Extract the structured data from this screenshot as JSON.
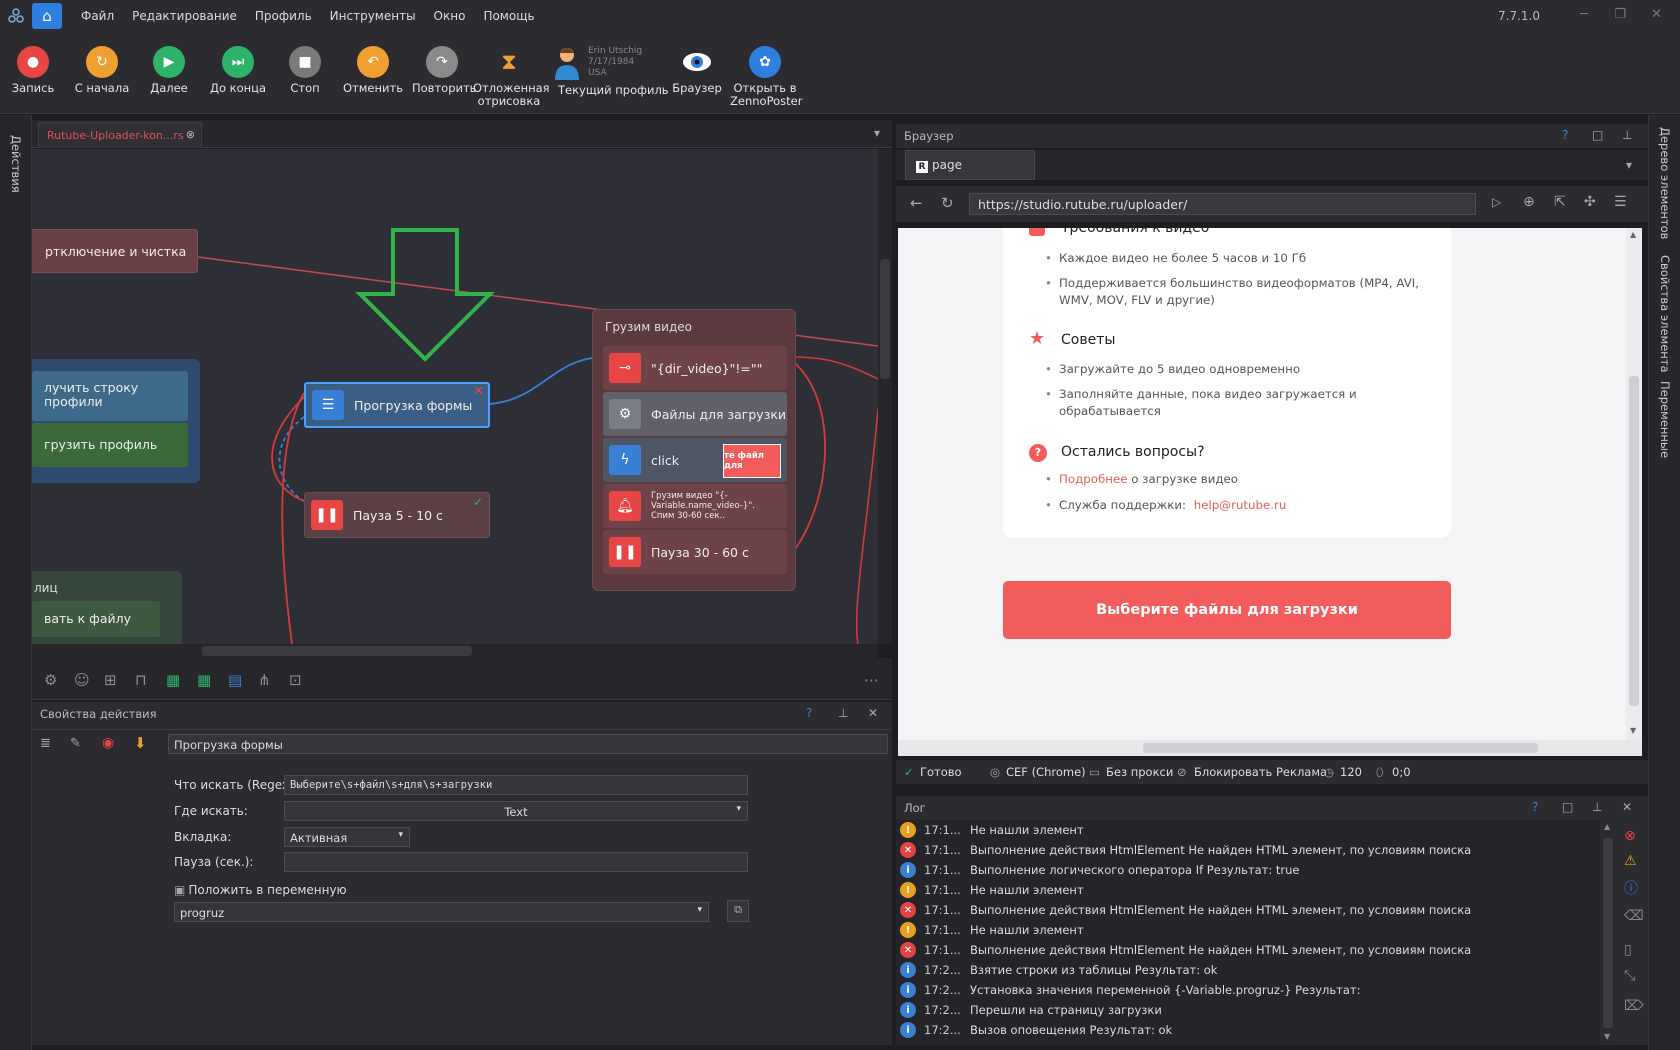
{
  "menu": {
    "items": [
      "Файл",
      "Редактирование",
      "Профиль",
      "Инструменты",
      "Окно",
      "Помощь"
    ],
    "version": "7.7.1.0"
  },
  "toolbar": {
    "buttons": [
      {
        "label": "Запись",
        "color": "#e84545"
      },
      {
        "label": "С начала",
        "color": "#f0a030"
      },
      {
        "label": "Далее",
        "color": "#2fb36a"
      },
      {
        "label": "До конца",
        "color": "#2fb36a"
      },
      {
        "label": "Стоп",
        "color": "#7a7a7a"
      },
      {
        "label": "Отменить",
        "color": "#f0a030"
      },
      {
        "label": "Повторить",
        "color": "#8a8a8a"
      },
      {
        "label": "Отложенная отрисовка",
        "color": "#f0a030"
      }
    ],
    "profile": {
      "name": "Erin Utschig",
      "dob": "7/17/1984",
      "country": "USA",
      "label": "Текущий профиль"
    },
    "browser_label": "Браузер",
    "zp_label": "Открыть в ZennoPoster"
  },
  "left_strip": {
    "label": "Действия"
  },
  "right_strip": {
    "items": [
      "Дерево элементов",
      "Свойства элемента",
      "Переменные"
    ]
  },
  "project_tab": {
    "title": "Rutube-Uploader-kon...rs"
  },
  "canvas": {
    "nodes": {
      "cleanup": "ртключение и чистка",
      "get_row": "лучить строку профили",
      "load_profile": "грузить профиль",
      "form_load": "Прогрузка формы",
      "pause_short": "Пауза 5 - 10 с",
      "group_partial": "лиц",
      "file_path": "вать к файлу"
    },
    "group": {
      "title": "Грузим видео",
      "items": [
        {
          "label": "\"{dir_video}\"!=\"\""
        },
        {
          "label": "Файлы для загрузки"
        },
        {
          "label": "click",
          "thumb": "те файл для"
        },
        {
          "label": "Грузим видео \"{-Variable.name_video-}\". Спим 30-60 сек.."
        },
        {
          "label": "Пауза 30 - 60 с"
        }
      ]
    }
  },
  "properties": {
    "title": "Свойства действия",
    "name": "Прогрузка формы",
    "fields": {
      "regex_label": "Что искать (Regex):",
      "regex_value": "Выберите\\s+файл\\s+для\\s+загрузки",
      "where_label": "Где искать:",
      "where_value": "Text",
      "tab_label": "Вкладка:",
      "tab_value": "Активная",
      "pause_label": "Пауза (сек.):",
      "save_label": "Положить в переменную",
      "var_value": "progruz"
    }
  },
  "browser": {
    "title": "Браузер",
    "tab": "page",
    "url": "https://studio.rutube.ru/uploader/",
    "page": {
      "req_title": "Требования к видео",
      "req_items": [
        "Каждое видео не более 5 часов и 10 Гб",
        "Поддерживается большинство видеоформатов (MP4, AVI,",
        "WMV, MOV, FLV и другие)"
      ],
      "tips_title": "Советы",
      "tips_items": [
        "Загружайте до 5 видео одновременно",
        "Заполняйте данные, пока видео загружается и",
        "обрабатывается"
      ],
      "q_title": "Остались вопросы?",
      "q_more_link": "Подробнее",
      "q_more_rest": " о загрузке видео",
      "q_support": "Служба поддержки: ",
      "q_email": "help@rutube.ru",
      "upload_btn": "Выберите файлы для загрузки"
    },
    "status": {
      "ready": "Готово",
      "engine": "CEF (Chrome)",
      "proxy": "Без прокси",
      "ads": "Блокировать Реклама",
      "timer": "120",
      "mouse": "0;0"
    }
  },
  "log": {
    "title": "Лог",
    "rows": [
      {
        "type": "warn",
        "time": "17:1...",
        "text": " Не нашли элемент"
      },
      {
        "type": "err",
        "time": "17:1...",
        "text": "Выполнение действия HtmlElement Не найден HTML элемент, по условиям поиска"
      },
      {
        "type": "info",
        "time": "17:1...",
        "text": "Выполнение логического оператора If  Результат: true"
      },
      {
        "type": "warn",
        "time": "17:1...",
        "text": " Не нашли элемент"
      },
      {
        "type": "err",
        "time": "17:1...",
        "text": "Выполнение действия HtmlElement Не найден HTML элемент, по условиям поиска"
      },
      {
        "type": "warn",
        "time": "17:1...",
        "text": " Не нашли элемент"
      },
      {
        "type": "err",
        "time": "17:1...",
        "text": "Выполнение действия HtmlElement Не найден HTML элемент, по условиям поиска"
      },
      {
        "type": "info",
        "time": "17:2...",
        "text": "Взятие строки из таблицы  Результат: ok"
      },
      {
        "type": "info",
        "time": "17:2...",
        "text": "Установка значения переменной {-Variable.progruz-}  Результат:"
      },
      {
        "type": "info",
        "time": "17:2...",
        "text": "Перешли на страницу загрузки"
      },
      {
        "type": "info",
        "time": "17:2...",
        "text": "Вызов оповещения  Результат: ok"
      }
    ]
  }
}
